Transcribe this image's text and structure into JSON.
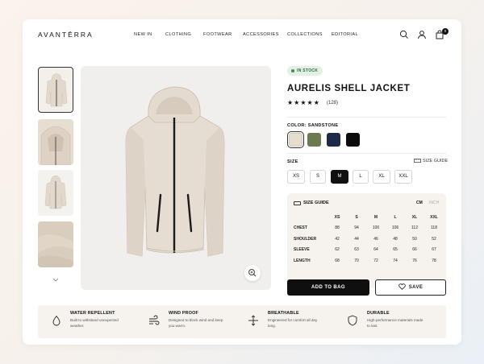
{
  "brand": "AVANTĒRRA",
  "nav": [
    "NEW IN",
    "CLOTHING",
    "FOOTWEAR",
    "ACCESSORIES",
    "COLLECTIONS",
    "EDITORIAL"
  ],
  "cart_count": "0",
  "product": {
    "stock": "IN STOCK",
    "name": "AURELIS SHELL JACKET",
    "stars": "★★★★★",
    "reviews": "(128)",
    "color_label": "COLOR: SANDSTONE",
    "swatches": [
      "#e6ddd1",
      "#6c7a52",
      "#1f2a4a",
      "#0b0b0b"
    ],
    "size_label": "SIZE",
    "size_guide_link": "SIZE GUIDE",
    "sizes": [
      "XS",
      "S",
      "M",
      "L",
      "XL",
      "XXL"
    ],
    "selected_size": "M"
  },
  "size_guide": {
    "title": "SIZE GUIDE",
    "unit_cm": "CM",
    "unit_inch": "INCH",
    "headers": [
      "",
      "XS",
      "S",
      "M",
      "L",
      "XL",
      "XXL"
    ],
    "rows": [
      {
        "name": "CHEST",
        "values": [
          "88",
          "94",
          "100",
          "106",
          "112",
          "118"
        ]
      },
      {
        "name": "SHOULDER",
        "values": [
          "42",
          "44",
          "46",
          "48",
          "50",
          "52"
        ]
      },
      {
        "name": "SLEEVE",
        "values": [
          "62",
          "63",
          "64",
          "65",
          "66",
          "67"
        ]
      },
      {
        "name": "LENGTH",
        "values": [
          "68",
          "70",
          "72",
          "74",
          "76",
          "78"
        ]
      }
    ]
  },
  "actions": {
    "add_to_bag": "ADD TO BAG",
    "save": "SAVE"
  },
  "features": [
    {
      "title": "WATER REPELLENT",
      "desc": "Built to withstand unexpected weather.",
      "icon": "droplet-icon"
    },
    {
      "title": "WIND PROOF",
      "desc": "Designed to block wind and keep you warm.",
      "icon": "wind-icon"
    },
    {
      "title": "BREATHABLE",
      "desc": "Engineered for comfort all day long.",
      "icon": "breathable-icon"
    },
    {
      "title": "DURABLE",
      "desc": "High-performance materials made to last.",
      "icon": "shield-icon"
    }
  ]
}
